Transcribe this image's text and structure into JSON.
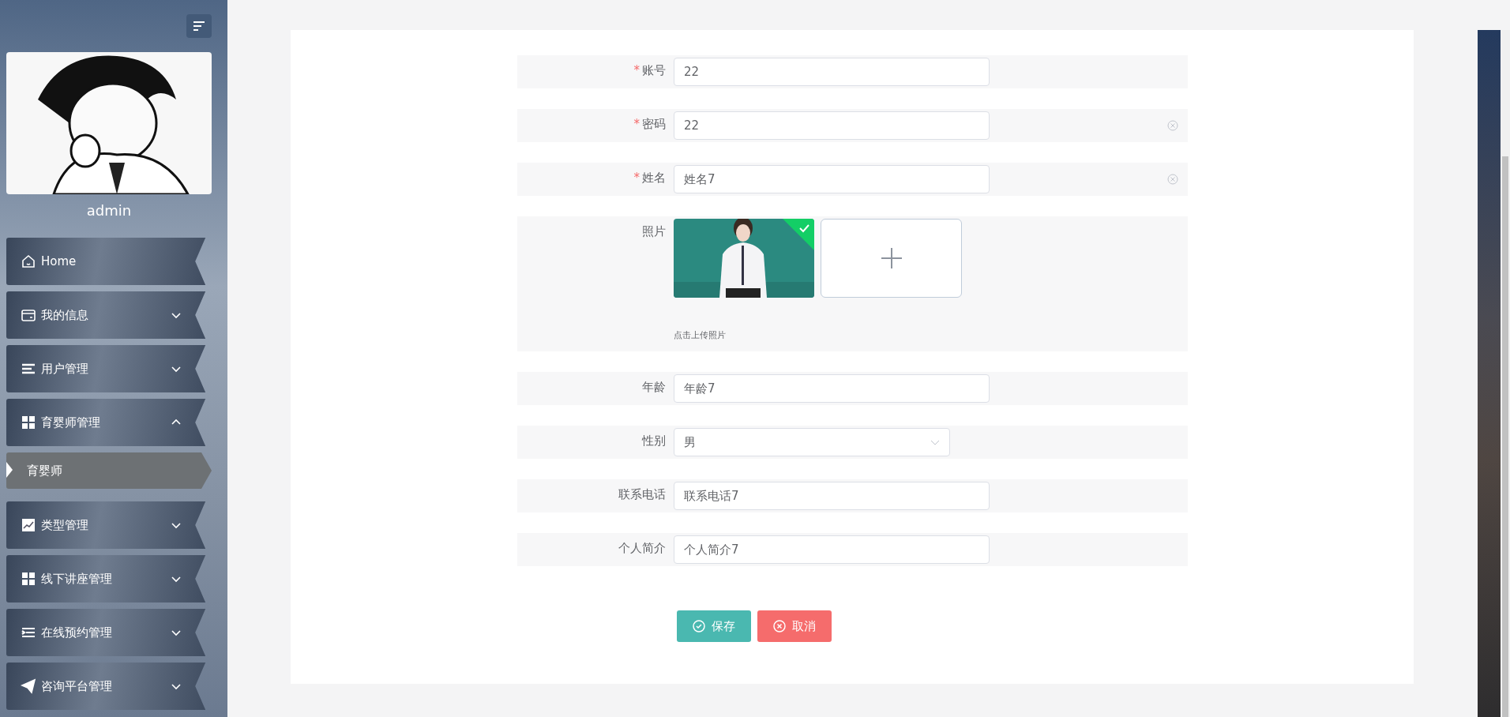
{
  "sidebar": {
    "user_name": "admin",
    "menu": [
      {
        "label": "Home"
      },
      {
        "label": "我的信息",
        "expanded": false
      },
      {
        "label": "用户管理",
        "expanded": false
      },
      {
        "label": "育婴师管理",
        "expanded": true,
        "children": [
          {
            "label": "育婴师",
            "selected": true
          }
        ]
      },
      {
        "label": "类型管理",
        "expanded": false
      },
      {
        "label": "线下讲座管理",
        "expanded": false
      },
      {
        "label": "在线预约管理",
        "expanded": false
      },
      {
        "label": "咨询平台管理",
        "expanded": false
      }
    ]
  },
  "form": {
    "fields": [
      {
        "kind": "input",
        "required_mark": "*",
        "label": "账号",
        "value": "22",
        "clear_icon": false
      },
      {
        "kind": "input",
        "required_mark": "*",
        "label": "密码",
        "value": "22",
        "clear_icon": true
      },
      {
        "kind": "input",
        "required_mark": "*",
        "label": "姓名",
        "value": "姓名7",
        "clear_icon": true
      },
      {
        "kind": "upload",
        "label": "照片",
        "hint": "点击上传照片",
        "uploaded": true
      },
      {
        "kind": "input",
        "label": "年龄",
        "value": "年龄7",
        "clear_icon": false
      },
      {
        "kind": "select",
        "label": "性别",
        "value": "男"
      },
      {
        "kind": "input",
        "label": "联系电话",
        "value": "联系电话7",
        "clear_icon": false
      },
      {
        "kind": "input",
        "label": "个人简介",
        "value": "个人简介7",
        "clear_icon": false
      }
    ],
    "buttons": [
      {
        "kind": "save",
        "label": "保存"
      },
      {
        "kind": "cancel",
        "label": "取消"
      }
    ]
  }
}
